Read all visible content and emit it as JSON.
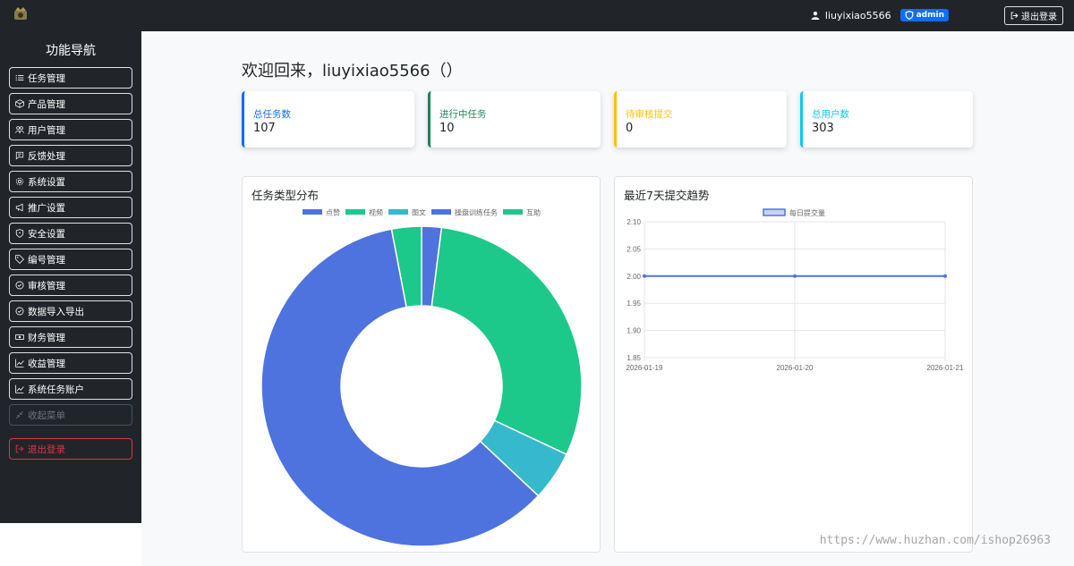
{
  "header": {
    "username": "liuyixiao5566",
    "role_badge": "admin",
    "logout_label": "退出登录"
  },
  "sidebar": {
    "title": "功能导航",
    "items": [
      {
        "label": "任务管理",
        "icon": "list-icon"
      },
      {
        "label": "产品管理",
        "icon": "box-icon"
      },
      {
        "label": "用户管理",
        "icon": "people-icon"
      },
      {
        "label": "反馈处理",
        "icon": "chat-icon"
      },
      {
        "label": "系统设置",
        "icon": "gear-icon"
      },
      {
        "label": "推广设置",
        "icon": "megaphone-icon"
      },
      {
        "label": "安全设置",
        "icon": "shield-icon"
      },
      {
        "label": "编号管理",
        "icon": "tag-icon"
      },
      {
        "label": "审核管理",
        "icon": "check-circle-icon"
      },
      {
        "label": "数据导入导出",
        "icon": "check-circle-icon"
      },
      {
        "label": "财务管理",
        "icon": "cash-icon"
      },
      {
        "label": "收益管理",
        "icon": "graph-icon"
      },
      {
        "label": "系统任务账户",
        "icon": "graph-icon"
      }
    ],
    "collapse_label": "收起菜单",
    "logout_label": "退出登录"
  },
  "main": {
    "welcome": "欢迎回来，liuyixiao5566（）",
    "stats": [
      {
        "label": "总任务数",
        "value": "107",
        "color": "#0d6efd"
      },
      {
        "label": "进行中任务",
        "value": "10",
        "color": "#198754"
      },
      {
        "label": "待审核提交",
        "value": "0",
        "color": "#ffc107"
      },
      {
        "label": "总用户数",
        "value": "303",
        "color": "#0dcaf0"
      }
    ],
    "pie_panel_title": "任务类型分布",
    "line_panel_title": "最近7天提交趋势"
  },
  "watermark": "https://www.huzhan.com/ishop26963",
  "chart_data": [
    {
      "type": "pie",
      "title": "任务类型分布",
      "legend_position": "top",
      "categories": [
        "点赞",
        "视频",
        "图文",
        "操盘训练任务",
        "互助"
      ],
      "values": [
        2,
        30,
        5,
        60,
        3
      ],
      "colors": [
        "#4e73df",
        "#1cc88a",
        "#36b9cc",
        "#4e73df",
        "#1cc88a"
      ]
    },
    {
      "type": "line",
      "title": "最近7天提交趋势",
      "legend_position": "top",
      "x": [
        "2026-01-19",
        "2026-01-20",
        "2026-01-21"
      ],
      "series": [
        {
          "name": "每日提交量",
          "values": [
            2,
            2,
            2
          ],
          "color": "#4e73df"
        }
      ],
      "ylim": [
        1.85,
        2.1
      ],
      "yticks": [
        "2.10",
        "2.05",
        "2.00",
        "1.95",
        "1.90",
        "1.85"
      ],
      "grid": true
    }
  ]
}
